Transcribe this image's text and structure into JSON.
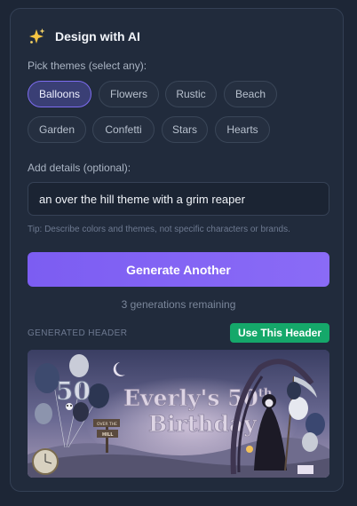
{
  "header": {
    "icon": "sparkles-icon",
    "title": "Design with AI"
  },
  "themes": {
    "label": "Pick themes (select any):",
    "chips": [
      {
        "label": "Balloons",
        "selected": true
      },
      {
        "label": "Flowers",
        "selected": false
      },
      {
        "label": "Rustic",
        "selected": false
      },
      {
        "label": "Beach",
        "selected": false
      },
      {
        "label": "Garden",
        "selected": false
      },
      {
        "label": "Confetti",
        "selected": false
      },
      {
        "label": "Stars",
        "selected": false
      },
      {
        "label": "Hearts",
        "selected": false
      }
    ]
  },
  "details": {
    "label": "Add details (optional):",
    "value": "an over the hill theme with a grim reaper",
    "tip": "Tip: Describe colors and themes, not specific characters or brands."
  },
  "generate_button": "Generate Another",
  "remaining": "3 generations remaining",
  "generated": {
    "section_label": "GENERATED HEADER",
    "use_button": "Use This Header",
    "image_text": {
      "title_line1": "Everly's 50",
      "title_sup": "th",
      "title_line2": "Birthday",
      "balloon_number": "50",
      "sign_text_1": "OVER THE",
      "sign_text_2": "HILL"
    }
  },
  "colors": {
    "accent": "#7c5df2",
    "success": "#15a86a",
    "panel": "#212b3c"
  }
}
